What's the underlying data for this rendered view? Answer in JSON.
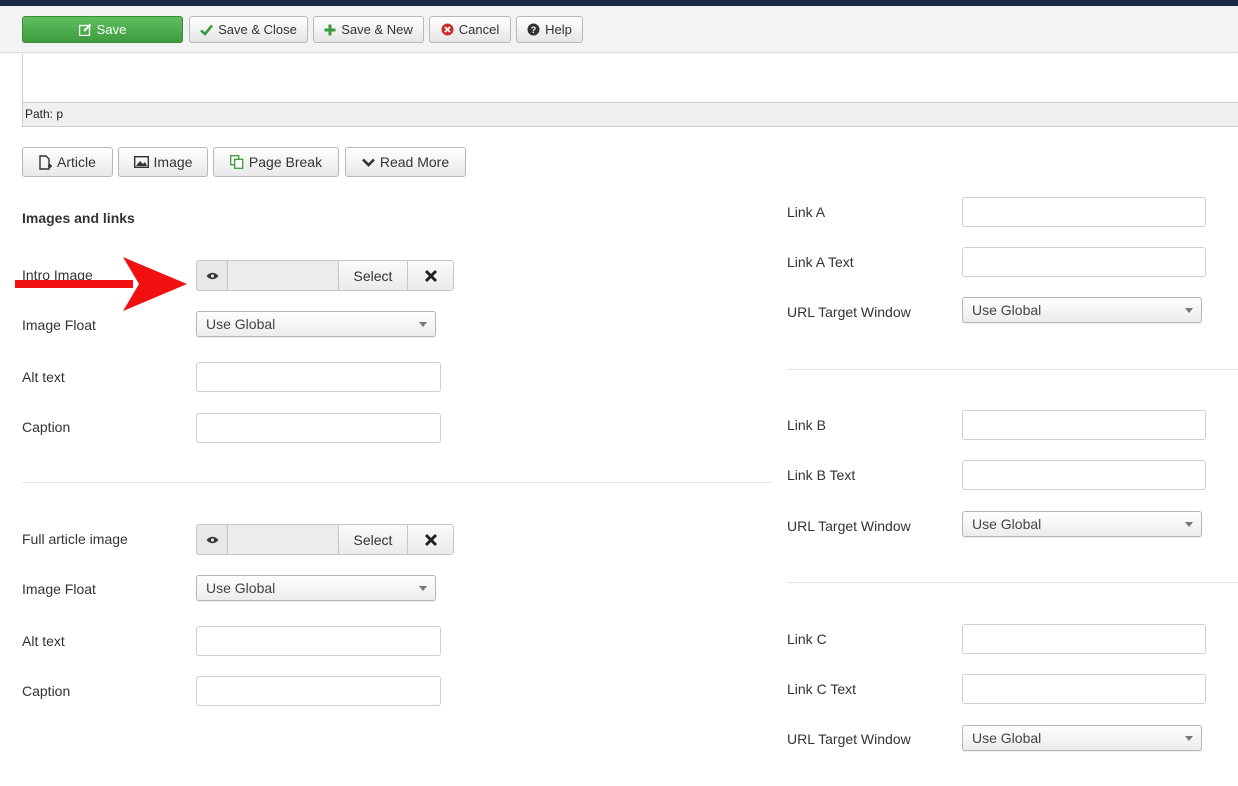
{
  "toolbar": {
    "save": "Save",
    "save_close": "Save & Close",
    "save_new": "Save & New",
    "cancel": "Cancel",
    "help": "Help"
  },
  "editor": {
    "path": "Path: p"
  },
  "editor_buttons": {
    "article": "Article",
    "image": "Image",
    "page_break": "Page Break",
    "read_more": "Read More"
  },
  "images": {
    "heading": "Images and links",
    "intro_image_label": "Intro Image",
    "select_label": "Select",
    "image_float_label": "Image Float",
    "image_float_value": "Use Global",
    "alt_text_label": "Alt text",
    "caption_label": "Caption",
    "full_image_label": "Full article image"
  },
  "links": {
    "link_a": "Link A",
    "link_a_text": "Link A Text",
    "link_b": "Link B",
    "link_b_text": "Link B Text",
    "link_c": "Link C",
    "link_c_text": "Link C Text",
    "target_label": "URL Target Window",
    "target_value": "Use Global"
  },
  "colors": {
    "topbar": "#1a2a44",
    "save_green": "#47a447",
    "annotation_arrow": "#f01010"
  },
  "icons": [
    "edit-icon",
    "check-icon",
    "plus-icon",
    "cancel-icon",
    "help-icon",
    "article-icon",
    "image-icon",
    "page-break-icon",
    "read-more-icon",
    "eye-icon",
    "clear-icon",
    "arrow-annotation"
  ]
}
